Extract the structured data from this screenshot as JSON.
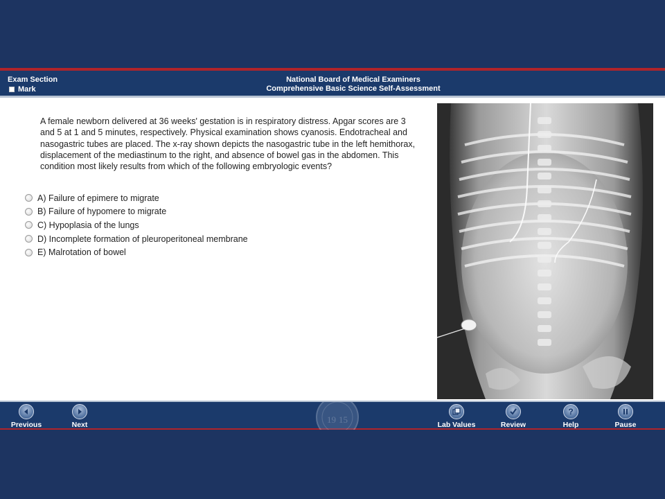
{
  "header": {
    "exam_section": "Exam Section",
    "mark_label": "Mark",
    "org_name": "National Board of Medical Examiners",
    "exam_name": "Comprehensive Basic Science Self-Assessment"
  },
  "question": {
    "stem": "A female newborn delivered at 36 weeks' gestation is in respiratory distress. Apgar scores are 3 and 5 at 1 and 5 minutes, respectively. Physical examination shows cyanosis. Endotracheal and nasogastric tubes are placed. The x-ray shown depicts the nasogastric tube in the left hemithorax, displacement of the mediastinum to the right, and absence of bowel gas in the abdomen. This condition most likely results from which of the following embryologic events?",
    "options": [
      {
        "label": "A) Failure of epimere to migrate"
      },
      {
        "label": "B) Failure of hypomere to migrate"
      },
      {
        "label": "C) Hypoplasia of the lungs"
      },
      {
        "label": "D) Incomplete formation of pleuroperitoneal membrane"
      },
      {
        "label": "E) Malrotation of bowel"
      }
    ]
  },
  "footer": {
    "previous": "Previous",
    "next": "Next",
    "lab_values": "Lab Values",
    "review": "Review",
    "help": "Help",
    "pause": "Pause",
    "seal_left": "19",
    "seal_right": "15"
  },
  "colors": {
    "header_bg": "#1b3a6b",
    "accent_red": "#b0242a",
    "outer_bg": "#1d3461"
  }
}
